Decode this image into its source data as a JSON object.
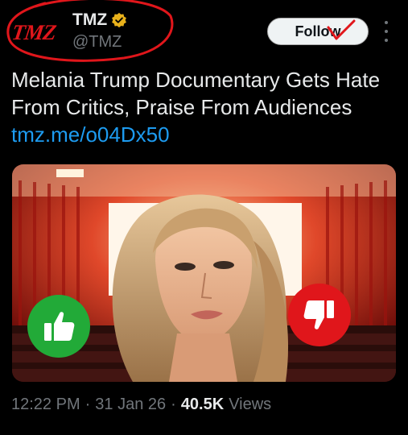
{
  "account": {
    "avatar_text": "TMZ",
    "display_name": "TMZ",
    "handle": "@TMZ",
    "verified": "gold-check"
  },
  "actions": {
    "follow_label": "Follow"
  },
  "tweet": {
    "text_line1": "Melania Trump Documentary Gets Hate",
    "text_line2": "From Critics, Praise From Audiences",
    "link": "tmz.me/o04Dx50"
  },
  "media": {
    "thumbs_up_icon": "thumbs-up-icon",
    "thumbs_down_icon": "thumbs-down-icon",
    "thumbs_up_color": "#22aa38",
    "thumbs_down_color": "#e0161b"
  },
  "meta": {
    "time": "12:22 PM",
    "separator": "·",
    "date": "31 Jan 26",
    "views_count": "40.5K",
    "views_label": "Views"
  },
  "colors": {
    "background": "#000000",
    "text": "#e7e9ea",
    "secondary": "#71767b",
    "link": "#1d9bf0",
    "annotation_red": "#e0161b"
  }
}
